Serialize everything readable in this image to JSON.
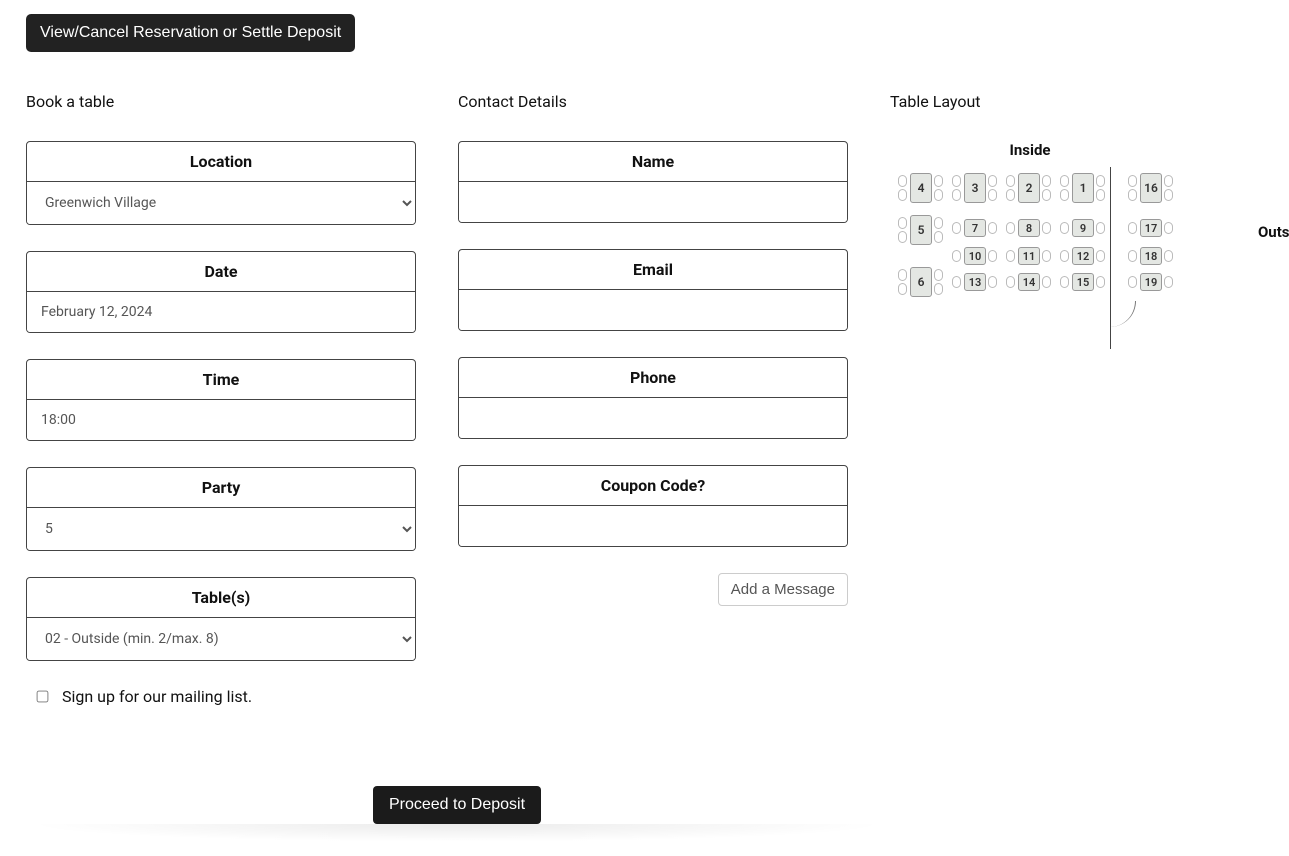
{
  "topButton": "View/Cancel Reservation or Settle Deposit",
  "sections": {
    "book": "Book a table",
    "contact": "Contact Details",
    "layout": "Table Layout"
  },
  "book": {
    "location_label": "Location",
    "location_value": "Greenwich Village",
    "date_label": "Date",
    "date_value": "February 12, 2024",
    "time_label": "Time",
    "time_value": "18:00",
    "party_label": "Party",
    "party_value": "5",
    "tables_label": "Table(s)",
    "tables_value": "02 - Outside (min. 2/max. 8)"
  },
  "contact": {
    "name_label": "Name",
    "name_value": "",
    "email_label": "Email",
    "email_value": "",
    "phone_label": "Phone",
    "phone_value": "",
    "coupon_label": "Coupon Code?",
    "coupon_value": "",
    "add_message": "Add a Message"
  },
  "mailing_label": "Sign up for our mailing list.",
  "proceed": "Proceed to Deposit",
  "layout": {
    "inside": "Inside",
    "outside": "Outside",
    "tables": {
      "t1": "1",
      "t2": "2",
      "t3": "3",
      "t4": "4",
      "t5": "5",
      "t6": "6",
      "t7": "7",
      "t8": "8",
      "t9": "9",
      "t10": "10",
      "t11": "11",
      "t12": "12",
      "t13": "13",
      "t14": "14",
      "t15": "15",
      "t16": "16",
      "t17": "17",
      "t18": "18",
      "t19": "19"
    }
  }
}
